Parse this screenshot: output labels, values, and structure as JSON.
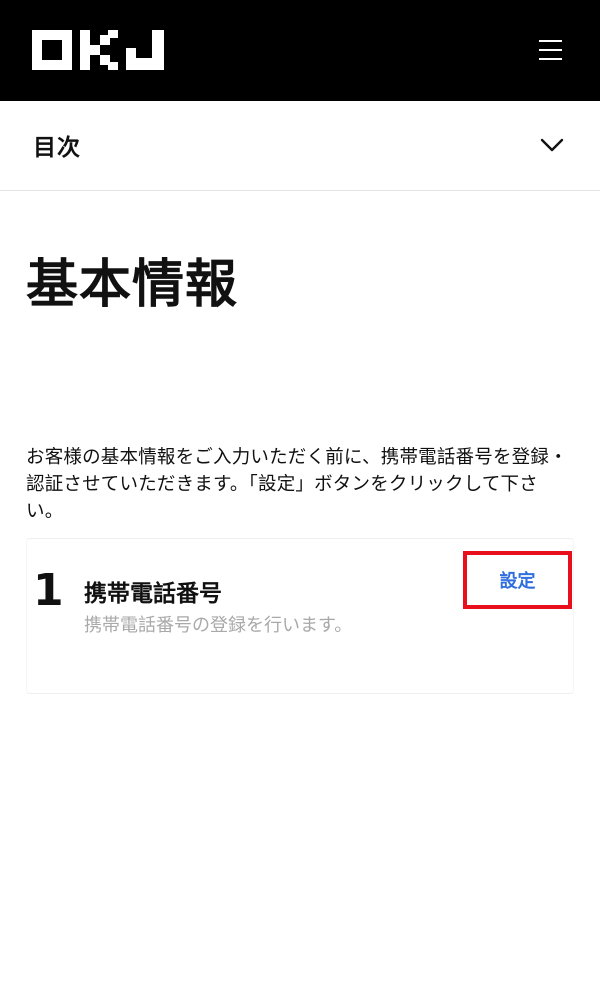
{
  "header": {
    "logo_text": "OKJ",
    "logo_icon": "okj-logo",
    "menu_icon": "hamburger-menu-icon"
  },
  "toc": {
    "label": "目次",
    "icon": "chevron-down-icon"
  },
  "main": {
    "title": "基本情報",
    "intro": "お客様の基本情報をご入力いただく前に、携帯電話番号を登録・認証させていただきます。「設定」ボタンをクリックして下さい。"
  },
  "steps": [
    {
      "number": "1",
      "title": "携帯電話番号",
      "description": "携帯電話番号の登録を行います。",
      "button_label": "設定"
    }
  ],
  "colors": {
    "header_bg": "#000000",
    "link_blue": "#2f6fde",
    "highlight_red": "#e8101c",
    "muted_gray": "#a9a9a9"
  }
}
